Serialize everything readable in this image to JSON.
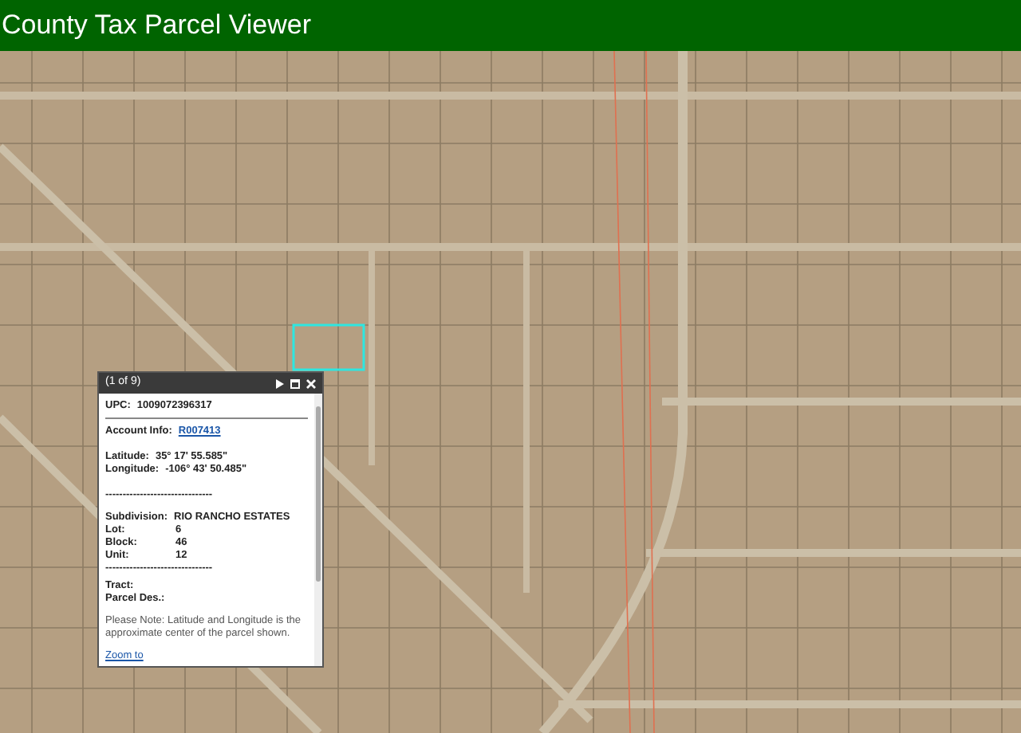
{
  "header": {
    "title": "County Tax Parcel Viewer"
  },
  "popup": {
    "counter": "(1 of 9)",
    "upc": {
      "label": "UPC:",
      "value": "1009072396317"
    },
    "account": {
      "label": "Account Info:",
      "link": "R007413"
    },
    "coordinates": [
      {
        "label": "Latitude:",
        "value": "35° 17' 55.585\""
      },
      {
        "label": "Longitude:",
        "value": "-106° 43' 50.485\""
      }
    ],
    "separator": "-------------------------------",
    "subdivision": {
      "label": "Subdivision:",
      "value": "RIO RANCHO ESTATES"
    },
    "details": [
      {
        "label": "Lot:",
        "value": "6"
      },
      {
        "label": "Block:",
        "value": "46"
      },
      {
        "label": "Unit:",
        "value": "12"
      }
    ],
    "separator_2": "-------------------------------",
    "extra": [
      {
        "label": "Tract:"
      },
      {
        "label": "Parcel Des.:"
      }
    ],
    "note": "Please Note: Latitude and Longitude is the approximate center of the parcel shown.",
    "zoom_link": "Zoom to"
  }
}
